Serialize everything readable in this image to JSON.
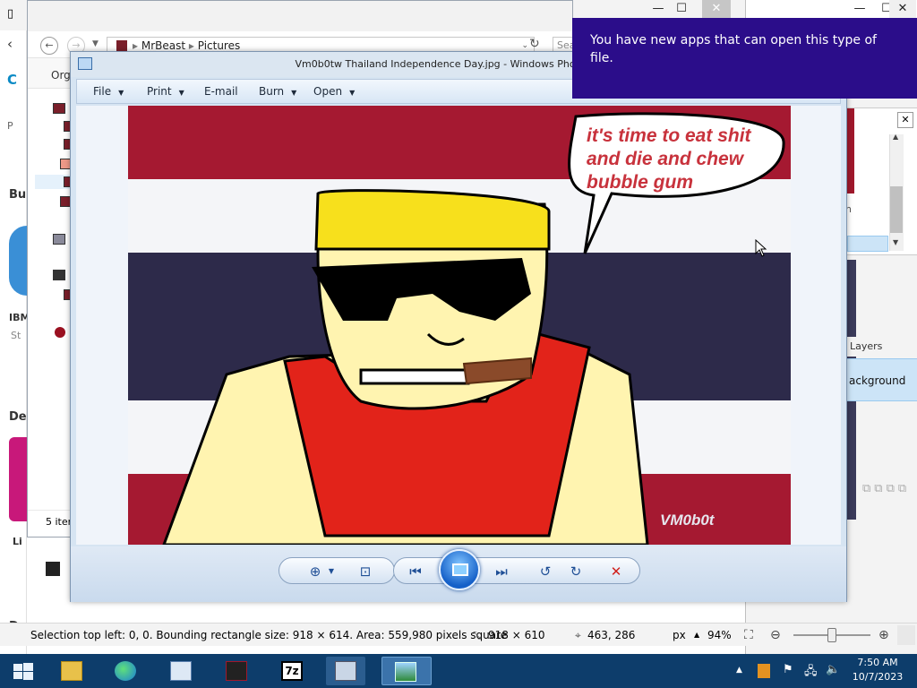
{
  "explorer": {
    "path": [
      "MrBeast",
      "Pictures"
    ],
    "search_placeholder": "Sea",
    "toolbar_label": "Org",
    "status": "5 item"
  },
  "background_fragments": {
    "left_b": "Bu",
    "left_ibm": "IBM",
    "left_de1": "De",
    "left_de2": "De",
    "left_li": "Li",
    "left_st": "St",
    "left_p": "P"
  },
  "viewer": {
    "title": "Vm0b0tw Thailand Independence Day.jpg - Windows Photo Viewer",
    "menu": [
      "File",
      "Print",
      "E-mail",
      "Burn",
      "Open"
    ],
    "image": {
      "speech": [
        "it's time to eat shit",
        "and die and chew",
        "bubble gum"
      ],
      "signature": "VM0b0t"
    }
  },
  "notification": {
    "text": "You have new apps that can open this type of file."
  },
  "paintnet": {
    "layers_label": "Layers",
    "background_layer": "ackground",
    "fragment_n": "n"
  },
  "statusbar": {
    "selection": "Selection top left: 0, 0. Bounding rectangle size: 918 × 614. Area: 559,980 pixels square",
    "size": "918 × 610",
    "cursor": "463, 286",
    "units": "px",
    "zoom": "94%"
  },
  "taskbar": {
    "time": "7:50 AM",
    "date": "10/7/2023"
  },
  "colors": {
    "thai_red": "#a51931",
    "thai_blue": "#2d2a4a",
    "notification_bg": "#2b0d8a",
    "taskbar_bg": "#0d3d6b"
  }
}
